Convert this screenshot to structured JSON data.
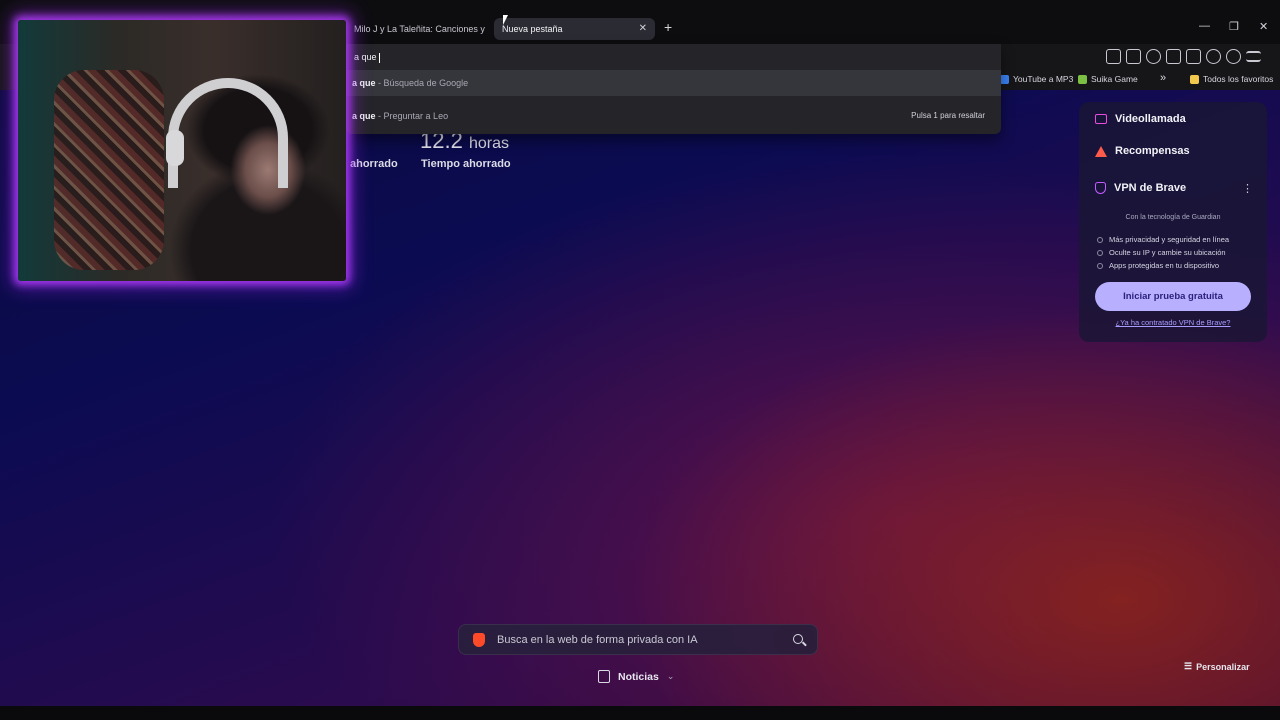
{
  "tabs": {
    "inactive_title": "Milo J y La Taleñita: Canciones y Mon",
    "active_title": "Nueva pestaña",
    "close_glyph": "✕",
    "new_tab_glyph": "+"
  },
  "window_controls": {
    "minimize": "—",
    "maximize": "❐",
    "close": "✕"
  },
  "omnibox": {
    "typed_text": "a que",
    "suggestions": [
      {
        "bold": "a que",
        "detail": "- Búsqueda de Google",
        "hint": ""
      },
      {
        "bold": "a que",
        "detail": "- Preguntar a Leo",
        "hint": "Pulsa 1 para resaltar"
      }
    ]
  },
  "bookmarks": [
    {
      "label": "YouTube a MP3",
      "color": "#3b82f6"
    },
    {
      "label": "Suika Game",
      "color": "#7bc043"
    },
    {
      "label": "»",
      "color": ""
    },
    {
      "label": "Todos los favoritos",
      "color": "#f2c94c"
    }
  ],
  "stats": {
    "time_value": "12.2",
    "time_unit": "horas",
    "label_left": "ahorrado",
    "label_right": "Tiempo ahorrado"
  },
  "panel": {
    "videocall": "Videollamada",
    "rewards": "Recompensas",
    "vpn_title": "VPN de Brave",
    "powered_by": "Con la tecnología de  Guardian",
    "features": [
      "Más privacidad y seguridad en línea",
      "Oculte su IP y cambie su ubicación",
      "Apps protegidas en tu dispositivo"
    ],
    "trial_button": "Iniciar prueba gratuita",
    "already_link": "¿Ya ha contratado VPN de Brave?",
    "menu_glyph": "⋮",
    "colors": {
      "videocall": "#e84cdb",
      "rewards": "#ff5a4a",
      "vpn": "#c65bff"
    }
  },
  "search": {
    "placeholder": "Busca en la web de forma privada con IA"
  },
  "news": {
    "label": "Noticias",
    "chevron": "⌄"
  },
  "customize": {
    "icon": "☰",
    "label": "Personalizar"
  }
}
